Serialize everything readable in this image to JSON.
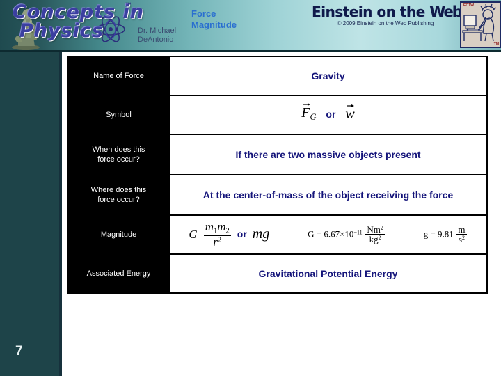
{
  "branding": {
    "wordmark_line1": "Concepts in",
    "wordmark_line2": "Physics",
    "trademark": "™",
    "author_line1": "Dr. Michael",
    "author_line2": "DeAntonio",
    "publisher_line1": "Einstein on the",
    "publisher_web": "Web",
    "publisher_copyright": "© 2009 Einstein on the  Web Publishing",
    "corner_tag_top": "EOTW",
    "corner_tag_bottom": "TM"
  },
  "slide": {
    "title_line1": "Force",
    "title_line2": "Magnitude",
    "page_number": "7"
  },
  "colors": {
    "sidebar": "#1e4449",
    "sidebar_edge": "#16313c",
    "label_cell_bg": "#000000",
    "label_cell_text": "#ffffff",
    "value_text": "#14147a",
    "title_blue": "#2a6fd0",
    "wordmark_purple": "#3b3fa0"
  },
  "table": {
    "rows": [
      {
        "label": "Name of Force",
        "value": "Gravity"
      },
      {
        "label": "Symbol",
        "value": "F⃗G  or  w⃗"
      },
      {
        "label": "When does this force occur?",
        "label_line1": "When does this",
        "label_line2": "force occur?",
        "value": "If there are two massive objects present"
      },
      {
        "label": "Where does this force occur?",
        "label_line1": "Where does this",
        "label_line2": "force occur?",
        "value": "At the center-of-mass of the object receiving the force"
      },
      {
        "label": "Magnitude",
        "value": "G m₁m₂ / r²  or  mg"
      },
      {
        "label": "Associated Energy",
        "value": "Gravitational Potential Energy"
      }
    ],
    "symbol_row": {
      "sym1_base": "F",
      "sym1_sub": "G",
      "connector": "or",
      "sym2_base": "w"
    },
    "magnitude_row": {
      "G": "G",
      "num_m1": "m",
      "num_m1_sub": "1",
      "num_m2": "m",
      "num_m2_sub": "2",
      "den_r": "r",
      "den_exp": "2",
      "connector": "or",
      "mg": "mg",
      "constant_G_lhs": "G = 6.67×10",
      "constant_G_exp": "−11",
      "constant_G_unit_num": "Nm",
      "constant_G_unit_num_exp": "2",
      "constant_G_unit_den": "kg",
      "constant_G_unit_den_exp": "2",
      "constant_g_lhs": "g = 9.81",
      "constant_g_unit_num": "m",
      "constant_g_unit_den": "s",
      "constant_g_unit_den_exp": "2"
    }
  }
}
